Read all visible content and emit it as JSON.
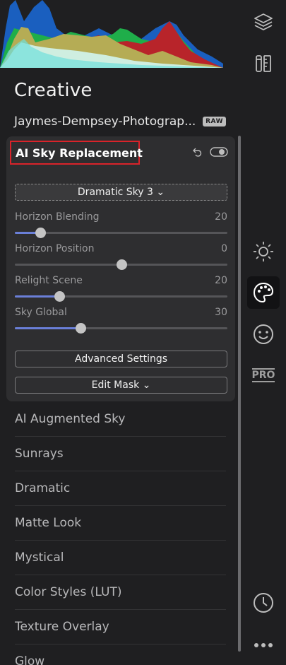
{
  "section_title": "Creative",
  "file": {
    "name": "Jaymes-Dempsey-Photograp...",
    "badge": "RAW"
  },
  "panel": {
    "title": "AI Sky Replacement",
    "preset_label": "Dramatic Sky 3 ⌄",
    "sliders": [
      {
        "label": "Horizon Blending",
        "value": "20",
        "fraction": 0.12
      },
      {
        "label": "Horizon Position",
        "value": "0",
        "fraction": 0.5
      },
      {
        "label": "Relight Scene",
        "value": "20",
        "fraction": 0.21
      },
      {
        "label": "Sky Global",
        "value": "30",
        "fraction": 0.31
      }
    ],
    "advanced_label": "Advanced Settings",
    "edit_mask_label": "Edit Mask ⌄"
  },
  "filters": [
    "AI Augmented Sky",
    "Sunrays",
    "Dramatic",
    "Matte Look",
    "Mystical",
    "Color Styles (LUT)",
    "Texture Overlay",
    "Glow"
  ],
  "right_bar": {
    "icons": [
      "layers-icon",
      "tools-icon",
      "sun-icon",
      "palette-icon",
      "smiley-icon",
      "pro-icon",
      "history-icon",
      "more-icon"
    ],
    "pro_label": "PRO",
    "active": "palette-icon"
  },
  "colors": {
    "accent": "#6a7fd8",
    "highlight_border": "#d9232a"
  }
}
